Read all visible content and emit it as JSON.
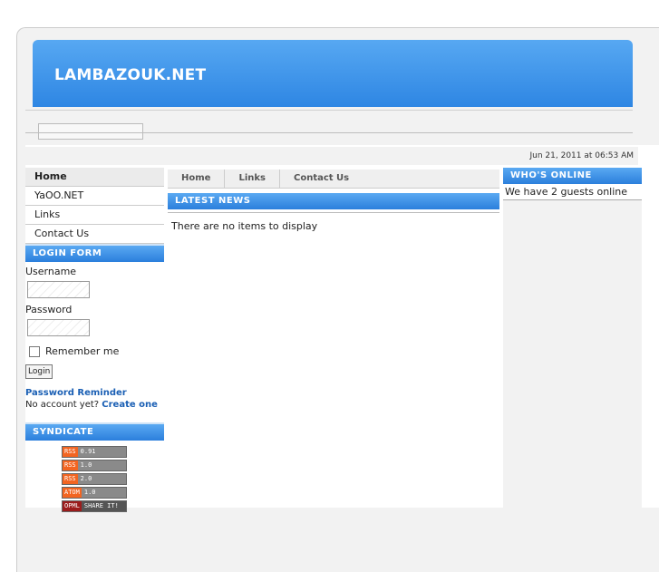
{
  "site": {
    "title": "LAMBAZOUK.NET"
  },
  "date": "Jun 21, 2011 at 06:53 AM",
  "left_menu": [
    {
      "label": "Home"
    },
    {
      "label": "YaOO.NET"
    },
    {
      "label": "Links"
    },
    {
      "label": "Contact Us"
    }
  ],
  "login_form": {
    "heading": "LOGIN FORM",
    "username_label": "Username",
    "password_label": "Password",
    "remember_label": "Remember me",
    "login_button": "Login",
    "password_reminder": "Password Reminder",
    "no_account": "No account yet?",
    "create_one": "Create one"
  },
  "syndicate": {
    "heading": "SYNDICATE",
    "feeds": [
      {
        "left": "RSS",
        "right": "0.91"
      },
      {
        "left": "RSS",
        "right": "1.0"
      },
      {
        "left": "RSS",
        "right": "2.0"
      },
      {
        "left": "ATOM",
        "right": "1.0"
      },
      {
        "left": "OPML",
        "right": "SHARE IT!"
      }
    ]
  },
  "top_nav": [
    {
      "label": "Home"
    },
    {
      "label": "Links"
    },
    {
      "label": "Contact Us"
    }
  ],
  "latest_news": {
    "heading": "LATEST NEWS",
    "text": "There are no items to display"
  },
  "whos_online": {
    "heading": "WHO'S ONLINE",
    "text": "We have 2 guests online"
  },
  "colors": {
    "accent": "#2e86e3",
    "link": "#1a5fb4"
  }
}
